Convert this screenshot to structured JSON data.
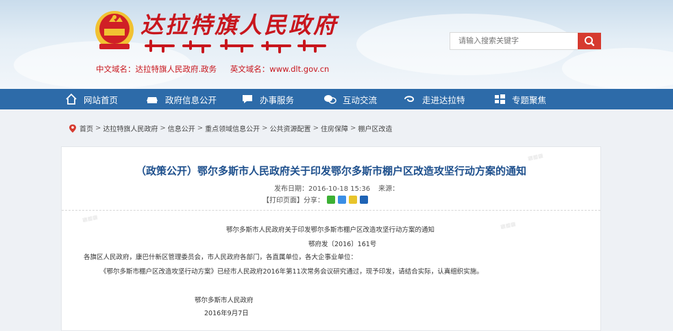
{
  "header": {
    "site_title": "达拉特旗人民政府",
    "cn_domain": "中文域名：达拉特旗人民政府.政务",
    "en_domain": "英文域名：www.dlt.gov.cn",
    "search_placeholder": "请输入搜索关键字",
    "accent_color": "#c8161d"
  },
  "nav": {
    "items": [
      {
        "label": "网站首页",
        "icon": "home-icon"
      },
      {
        "label": "政府信息公开",
        "icon": "car-icon"
      },
      {
        "label": "办事服务",
        "icon": "chat-icon"
      },
      {
        "label": "互动交流",
        "icon": "bubbles-icon"
      },
      {
        "label": "走进达拉特",
        "icon": "swirl-icon"
      },
      {
        "label": "专题聚焦",
        "icon": "windows-icon"
      }
    ],
    "bg_color": "#2d6ba9"
  },
  "breadcrumb": {
    "items": [
      "首页",
      "达拉特旗人民政府",
      "信息公开",
      "重点领域信息公开",
      "公共资源配置",
      "住房保障",
      "棚户区改造"
    ],
    "sep": ">"
  },
  "article": {
    "title": "（政策公开）鄂尔多斯市人民政府关于印发鄂尔多斯市棚户区改造攻坚行动方案的通知",
    "date_label": "发布日期：",
    "date": "2016-10-18 15:36",
    "source_label": "来源：",
    "print_label": "【打印页面】",
    "share_label": "分享：",
    "doc_title": "鄂尔多斯市人民政府关于印发鄂尔多斯市棚户区改造攻坚行动方案的通知",
    "doc_no": "鄂府发〔2016〕161号",
    "recipients": "各旗区人民政府，康巴什新区管理委员会，市人民政府各部门，各直属单位，各大企事业单位：",
    "body": "《鄂尔多斯市棚户区改造攻坚行动方案》已经市人民政府2016年第11次常务会议研究通过，现予印发，请结合实际，认真组织实施。",
    "signer": "鄂尔多斯市人民政府",
    "sign_date": "2016年9月7日"
  }
}
